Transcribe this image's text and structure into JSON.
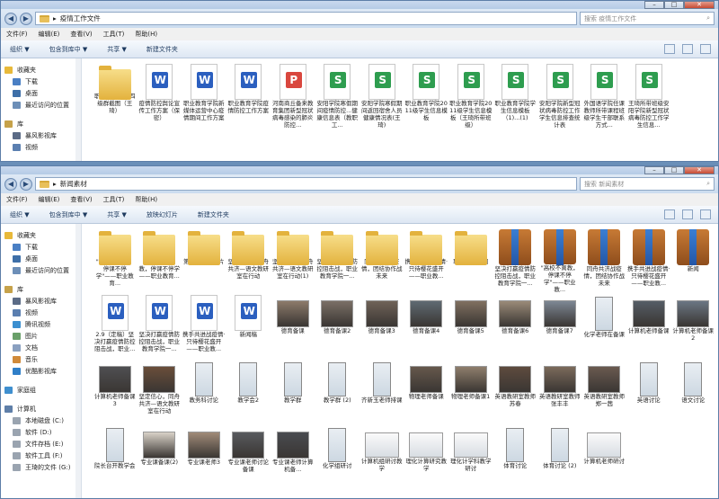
{
  "win1": {
    "path": "疫情工作文件",
    "search_placeholder": "搜索 疫情工作文件",
    "menu": [
      "文件(F)",
      "编辑(E)",
      "查看(V)",
      "工具(T)",
      "帮助(H)"
    ],
    "toolbar": [
      "组织 ▼",
      "包含到库中 ▼",
      "共享 ▼",
      "新建文件夹"
    ],
    "nav": [
      {
        "label": "收藏夹",
        "icon": "star-icon",
        "child": false
      },
      {
        "label": "下载",
        "icon": "download-icon",
        "child": true
      },
      {
        "label": "桌面",
        "icon": "desktop-icon",
        "child": true
      },
      {
        "label": "最近访问的位置",
        "icon": "recent-icon",
        "child": true
      },
      {
        "label": "库",
        "icon": "library-icon",
        "child": false
      },
      {
        "label": "暴风影视库",
        "icon": "video-library-icon",
        "child": true
      },
      {
        "label": "视频",
        "icon": "video-icon",
        "child": true
      }
    ],
    "files": [
      {
        "name": "职教三级群、四级群截图（王琦）",
        "type": "folder"
      },
      {
        "name": "疫情防控舆论宣传工作方案（保密）",
        "type": "doc"
      },
      {
        "name": "职业教育学院新媒体运营中心疫情期间工作方案",
        "type": "doc"
      },
      {
        "name": "职业教育学院疫情防控工作方案",
        "type": "doc"
      },
      {
        "name": "河南商丘备来教育集团新型冠状病毒感染的肺炎防控...",
        "type": "pdf"
      },
      {
        "name": "安阳学院寒假期间疫情防控...健康信息表（教职工...",
        "type": "xls"
      },
      {
        "name": "安阳学院寒假期间返回宿舍人员健康情况表(王琦)",
        "type": "xls"
      },
      {
        "name": "职业教育学院2011级学生信息模板",
        "type": "xls"
      },
      {
        "name": "职业教育学院2011级学生信息模板（王琦所带班级）",
        "type": "xls"
      },
      {
        "name": "职业教育学院学生信息模板（1)...(1)",
        "type": "xls"
      },
      {
        "name": "安阳学院新型冠状病毒防控工作学生信息排查统计表",
        "type": "xls"
      },
      {
        "name": "外国语学院任课教师所带课程班级学生干部联系方式...",
        "type": "xls"
      },
      {
        "name": "王琦所带班级安阳学院新型冠状病毒防控工作学生信息...",
        "type": "xls"
      }
    ]
  },
  "win2": {
    "path": "新闻素材",
    "search_placeholder": "搜索 新闻素材",
    "menu": [
      "文件(F)",
      "编辑(E)",
      "查看(V)",
      "工具(T)",
      "帮助(H)"
    ],
    "toolbar": [
      "组织 ▼",
      "包含到库中 ▼",
      "共享 ▼",
      "放映幻灯片",
      "新建文件夹"
    ],
    "nav": [
      {
        "label": "收藏夹",
        "icon": "star-icon",
        "child": false
      },
      {
        "label": "下载",
        "icon": "download-icon",
        "child": true
      },
      {
        "label": "桌面",
        "icon": "desktop-icon",
        "child": true
      },
      {
        "label": "最近访问的位置",
        "icon": "recent-icon",
        "child": true
      },
      {
        "label": "库",
        "icon": "library-icon",
        "child": false
      },
      {
        "label": "暴风影视库",
        "icon": "video-library-icon",
        "child": true
      },
      {
        "label": "视频",
        "icon": "video-icon",
        "child": true
      },
      {
        "label": "腾讯视频",
        "icon": "tencent-video-icon",
        "child": true
      },
      {
        "label": "图片",
        "icon": "pictures-icon",
        "child": true
      },
      {
        "label": "文档",
        "icon": "documents-icon",
        "child": true
      },
      {
        "label": "音乐",
        "icon": "music-icon",
        "child": true
      },
      {
        "label": "优酷影视库",
        "icon": "youku-library-icon",
        "child": true
      },
      {
        "label": "家庭组",
        "icon": "homegroup-icon",
        "child": false
      },
      {
        "label": "计算机",
        "icon": "computer-icon",
        "child": false
      },
      {
        "label": "本地磁盘 (C:)",
        "icon": "drive-icon",
        "child": true
      },
      {
        "label": "软件 (D:)",
        "icon": "drive-icon",
        "child": true
      },
      {
        "label": "文件存档 (E:)",
        "icon": "drive-icon",
        "child": true
      },
      {
        "label": "软件工具 (F:)",
        "icon": "drive-icon",
        "child": true
      },
      {
        "label": "王琦的文件 (G:)",
        "icon": "drive-icon",
        "child": true
      }
    ],
    "files": [
      {
        "name": "\"高校不离教，停课不停学\"——职业教育...",
        "type": "folder"
      },
      {
        "name": "2.9高校不离教，停课不停学——职业教育...",
        "type": "folder"
      },
      {
        "name": "第二次备课照片",
        "type": "folder"
      },
      {
        "name": "坚定信心，同舟共济—语文教研室在行动",
        "type": "folder"
      },
      {
        "name": "坚定信心，同舟共济—语文教研室在行动(1)",
        "type": "folder"
      },
      {
        "name": "坚决打赢疫情防控阻击战，职业教育学院一...",
        "type": "folder"
      },
      {
        "name": "同舟共济战疫情，团结协作战未来",
        "type": "folder"
      },
      {
        "name": "携手共进战疫情·只待樱花盛开——职业教...",
        "type": "folder"
      },
      {
        "name": "职教工作截图",
        "type": "folder"
      },
      {
        "name": "坚决打赢疫情防控阻击战，职业教育学院一...",
        "type": "zip"
      },
      {
        "name": "\"高校不离教，停课不停学\"——职业教...",
        "type": "zip"
      },
      {
        "name": "同舟共济战疫情，团结协作战未来",
        "type": "zip"
      },
      {
        "name": "携手共进战疫情·只待樱花盛开——职业教...",
        "type": "zip"
      },
      {
        "name": "新闻",
        "type": "zip"
      },
      {
        "name": "2.9（定稿）坚决打赢疫情防控阻击战，职业...",
        "type": "doc"
      },
      {
        "name": "坚决打赢疫情防控阻击战，职业教育学院一...",
        "type": "doc"
      },
      {
        "name": "携手共进战疫情·只待樱花盛开——职业教...",
        "type": "doc"
      },
      {
        "name": "新闻稿",
        "type": "doc"
      },
      {
        "name": "德育备课",
        "type": "img",
        "color": "#8c7a6a"
      },
      {
        "name": "德育备课2",
        "type": "img",
        "color": "#7a6f66"
      },
      {
        "name": "德育备课3",
        "type": "img",
        "color": "#6f6258"
      },
      {
        "name": "德育备课4",
        "type": "img",
        "color": "#5f6a72"
      },
      {
        "name": "德育备课5",
        "type": "img",
        "color": "#807060"
      },
      {
        "name": "德育备课6",
        "type": "img",
        "color": "#9a8a78"
      },
      {
        "name": "德育备课7",
        "type": "img",
        "color": "#7d8794"
      },
      {
        "name": "化学老师在备课",
        "type": "tall"
      },
      {
        "name": "计算机老师备课",
        "type": "img",
        "color": "#555d66"
      },
      {
        "name": "计算机老师备课2",
        "type": "img",
        "color": "#6b7683"
      },
      {
        "name": "计算机老师备课3",
        "type": "img",
        "color": "#4f4f52"
      },
      {
        "name": "坚定信心，同舟共济—语文教研室在行动",
        "type": "img",
        "color": "#6a4e3a"
      },
      {
        "name": "教务科讨论",
        "type": "tall"
      },
      {
        "name": "教学会2",
        "type": "tall"
      },
      {
        "name": "教学群",
        "type": "tall"
      },
      {
        "name": "教学群 (2)",
        "type": "tall"
      },
      {
        "name": "齐新玉老师排课",
        "type": "tall"
      },
      {
        "name": "物理老师备课",
        "type": "img",
        "color": "#66584c"
      },
      {
        "name": "物理老师备课1",
        "type": "img",
        "color": "#8e7e6c"
      },
      {
        "name": "英语教研室教师苏春",
        "type": "img",
        "color": "#5e4b3e"
      },
      {
        "name": "英语教研室教师张丰丰",
        "type": "img",
        "color": "#7b6a5b"
      },
      {
        "name": "英语教研室教师郑一茜",
        "type": "img",
        "color": "#6a5a50"
      },
      {
        "name": "英语讨论",
        "type": "tall"
      },
      {
        "name": "语文讨论",
        "type": "tall"
      },
      {
        "name": "院长台开教学会",
        "type": "tall"
      },
      {
        "name": "专业课备课(2)",
        "type": "img",
        "color": "#d9d2c8"
      },
      {
        "name": "专业课老师3",
        "type": "img",
        "color": "#a08a78"
      },
      {
        "name": "专业课老师讨论备课",
        "type": "img",
        "color": "#585a5e"
      },
      {
        "name": "专业课老师计算机备...",
        "type": "img",
        "color": "#494b50"
      },
      {
        "name": "化学组研讨",
        "type": "tall"
      },
      {
        "name": "计算机组研讨教学",
        "type": "screen"
      },
      {
        "name": "理化计算研究教学",
        "type": "screen"
      },
      {
        "name": "理化计学科教学研讨",
        "type": "screen"
      },
      {
        "name": "体育讨论",
        "type": "tall"
      },
      {
        "name": "体育讨论 (2)",
        "type": "tall"
      },
      {
        "name": "计算机老师研讨",
        "type": "screen"
      }
    ]
  }
}
